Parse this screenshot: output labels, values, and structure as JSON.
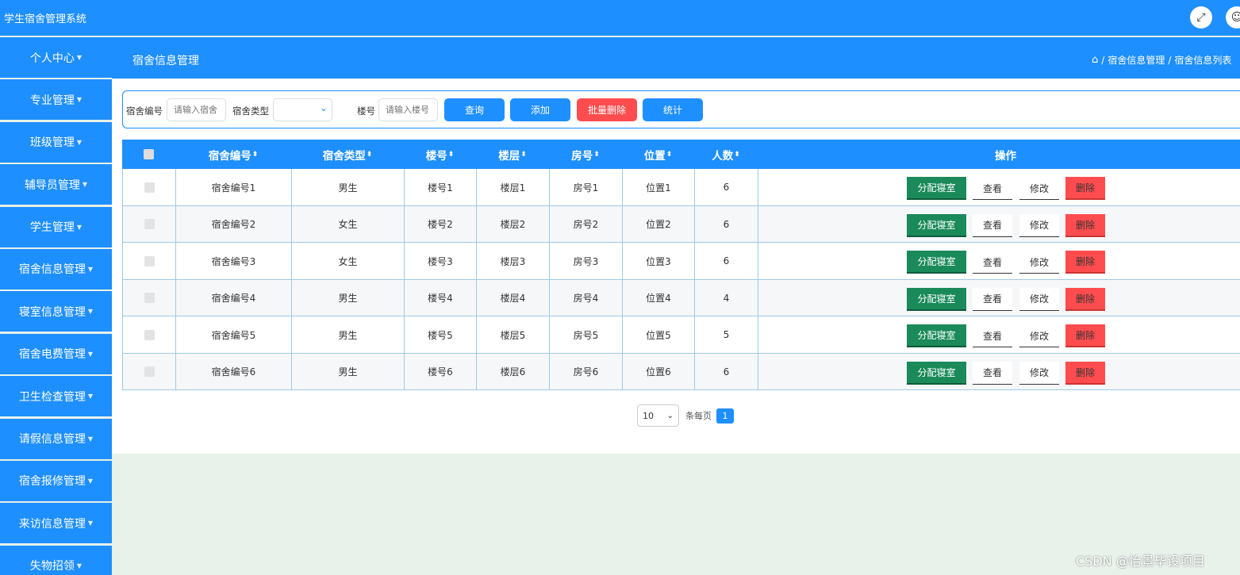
{
  "app": {
    "title": "学生宿舍管理系统",
    "fullscreen_icon": "fullscreen-icon",
    "user_icon": "user-icon"
  },
  "sidebar": {
    "items": [
      {
        "label": "个人中心"
      },
      {
        "label": "专业管理"
      },
      {
        "label": "班级管理"
      },
      {
        "label": "辅导员管理"
      },
      {
        "label": "学生管理"
      },
      {
        "label": "宿舍信息管理"
      },
      {
        "label": "寝室信息管理"
      },
      {
        "label": "宿舍电费管理"
      },
      {
        "label": "卫生检查管理"
      },
      {
        "label": "请假信息管理"
      },
      {
        "label": "宿舍报修管理"
      },
      {
        "label": "来访信息管理"
      },
      {
        "label": "失物招领"
      }
    ]
  },
  "header": {
    "page_title": "宿舍信息管理",
    "breadcrumb": [
      "宿舍信息管理",
      "宿舍信息列表"
    ]
  },
  "search": {
    "dorm_no_label": "宿舍编号",
    "dorm_no_placeholder": "请输入宿舍",
    "dorm_type_label": "宿舍类型",
    "dorm_type_value": "",
    "building_label": "楼号",
    "building_placeholder": "请输入楼号",
    "query_label": "查询",
    "add_label": "添加",
    "batch_delete_label": "批量删除",
    "stats_label": "统计"
  },
  "table": {
    "columns": [
      "宿舍编号",
      "宿舍类型",
      "楼号",
      "楼层",
      "房号",
      "位置",
      "人数",
      "操作"
    ],
    "rows": [
      {
        "no": "宿舍编号1",
        "type": "男生",
        "building": "楼号1",
        "floor": "楼层1",
        "room": "房号1",
        "location": "位置1",
        "count": "6"
      },
      {
        "no": "宿舍编号2",
        "type": "女生",
        "building": "楼号2",
        "floor": "楼层2",
        "room": "房号2",
        "location": "位置2",
        "count": "6"
      },
      {
        "no": "宿舍编号3",
        "type": "女生",
        "building": "楼号3",
        "floor": "楼层3",
        "room": "房号3",
        "location": "位置3",
        "count": "6"
      },
      {
        "no": "宿舍编号4",
        "type": "男生",
        "building": "楼号4",
        "floor": "楼层4",
        "room": "房号4",
        "location": "位置4",
        "count": "4"
      },
      {
        "no": "宿舍编号5",
        "type": "男生",
        "building": "楼号5",
        "floor": "楼层5",
        "room": "房号5",
        "location": "位置5",
        "count": "5"
      },
      {
        "no": "宿舍编号6",
        "type": "男生",
        "building": "楼号6",
        "floor": "楼层6",
        "room": "房号6",
        "location": "位置6",
        "count": "6"
      }
    ],
    "actions": {
      "assign": "分配寝室",
      "view": "查看",
      "edit": "修改",
      "delete": "删除"
    }
  },
  "pagination": {
    "page_size": "10",
    "per_page_label": "条每页",
    "current_page": "1"
  },
  "watermark": "CSDN @怡景毕设项目"
}
